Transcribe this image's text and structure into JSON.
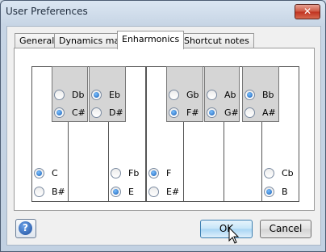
{
  "window": {
    "title": "User Preferences",
    "close_glyph": "✕"
  },
  "tabs": [
    {
      "label": "General",
      "active": false
    },
    {
      "label": "Dynamics map",
      "active": false
    },
    {
      "label": "Enharmonics",
      "active": true
    },
    {
      "label": "Shortcut notes",
      "active": false
    }
  ],
  "keys": {
    "black": [
      {
        "top": "Db",
        "top_selected": false,
        "bottom": "C#",
        "bottom_selected": true
      },
      {
        "top": "Eb",
        "top_selected": true,
        "bottom": "D#",
        "bottom_selected": false
      },
      {
        "top": "Gb",
        "top_selected": false,
        "bottom": "F#",
        "bottom_selected": true
      },
      {
        "top": "Ab",
        "top_selected": false,
        "bottom": "G#",
        "bottom_selected": true
      },
      {
        "top": "Bb",
        "top_selected": true,
        "bottom": "A#",
        "bottom_selected": false
      }
    ],
    "white": [
      {
        "top": "C",
        "top_selected": true,
        "bottom": "B#",
        "bottom_selected": false
      },
      {
        "top": "Fb",
        "top_selected": false,
        "bottom": "E",
        "bottom_selected": true
      },
      {
        "top": "F",
        "top_selected": true,
        "bottom": "E#",
        "bottom_selected": false
      },
      {
        "top": "Cb",
        "top_selected": false,
        "bottom": "B",
        "bottom_selected": true
      }
    ]
  },
  "buttons": {
    "help_glyph": "?",
    "ok": "OK",
    "cancel": "Cancel"
  }
}
